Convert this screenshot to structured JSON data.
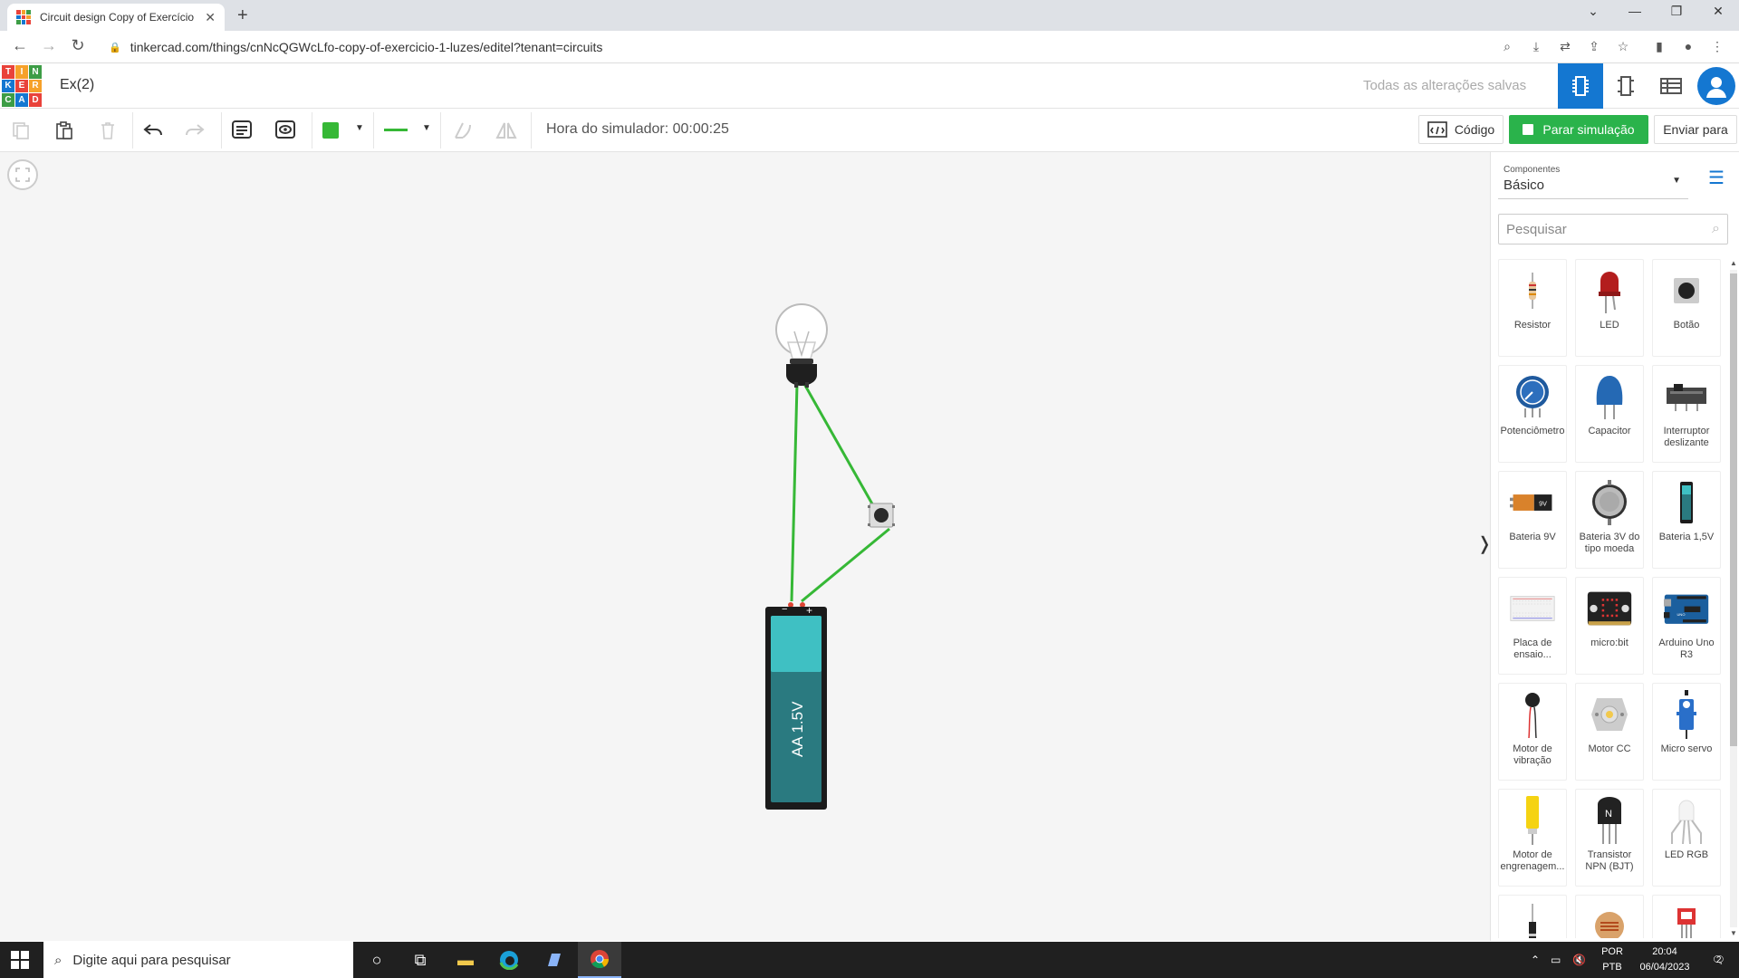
{
  "browser": {
    "tab_title": "Circuit design Copy of Exercício",
    "url": "tinkercad.com/things/cnNcQGWcLfo-copy-of-exercicio-1-luzes/editel?tenant=circuits"
  },
  "app": {
    "logo_letters": [
      "T",
      "I",
      "N",
      "K",
      "E",
      "R",
      "C",
      "A",
      "D"
    ],
    "doc_title": "Ex(2)",
    "save_status": "Todas as alterações salvas"
  },
  "toolbar": {
    "sim_time": "Hora do simulador: 00:00:25",
    "code_label": "Código",
    "stop_label": "Parar simulação",
    "send_label": "Enviar para",
    "color": "#36b836"
  },
  "canvas": {
    "battery_label": "AA 1.5V",
    "wire_color": "#36b836"
  },
  "panel": {
    "select_label": "Componentes",
    "select_value": "Básico",
    "search_placeholder": "Pesquisar",
    "components": [
      {
        "name": "Resistor",
        "icon": "resistor-icon"
      },
      {
        "name": "LED",
        "icon": "led-icon"
      },
      {
        "name": "Botão",
        "icon": "pushbutton-icon"
      },
      {
        "name": "Potenciômetro",
        "icon": "potentiometer-icon"
      },
      {
        "name": "Capacitor",
        "icon": "capacitor-icon"
      },
      {
        "name": "Interruptor deslizante",
        "icon": "slide-switch-icon"
      },
      {
        "name": "Bateria 9V",
        "icon": "battery-9v-icon"
      },
      {
        "name": "Bateria 3V do tipo moeda",
        "icon": "coin-battery-icon"
      },
      {
        "name": "Bateria 1,5V",
        "icon": "battery-1-5v-icon"
      },
      {
        "name": "Placa de ensaio...",
        "icon": "breadboard-icon"
      },
      {
        "name": "micro:bit",
        "icon": "microbit-icon"
      },
      {
        "name": "Arduino Uno R3",
        "icon": "arduino-icon"
      },
      {
        "name": "Motor de vibração",
        "icon": "vibration-motor-icon"
      },
      {
        "name": "Motor CC",
        "icon": "dc-motor-icon"
      },
      {
        "name": "Micro servo",
        "icon": "micro-servo-icon"
      },
      {
        "name": "Motor de engrenagem...",
        "icon": "gear-motor-icon"
      },
      {
        "name": "Transistor NPN (BJT)",
        "icon": "transistor-icon"
      },
      {
        "name": "LED RGB",
        "icon": "rgb-led-icon"
      },
      {
        "name": "",
        "icon": "diode-icon"
      },
      {
        "name": "",
        "icon": "photoresistor-icon"
      },
      {
        "name": "",
        "icon": "sensor-icon"
      }
    ],
    "transistor_letter": "N"
  },
  "taskbar": {
    "search_text": "Digite aqui para pesquisar",
    "lang_top": "POR",
    "lang_bottom": "PTB",
    "time": "20:04",
    "date": "06/04/2023",
    "notif_count": "2"
  }
}
